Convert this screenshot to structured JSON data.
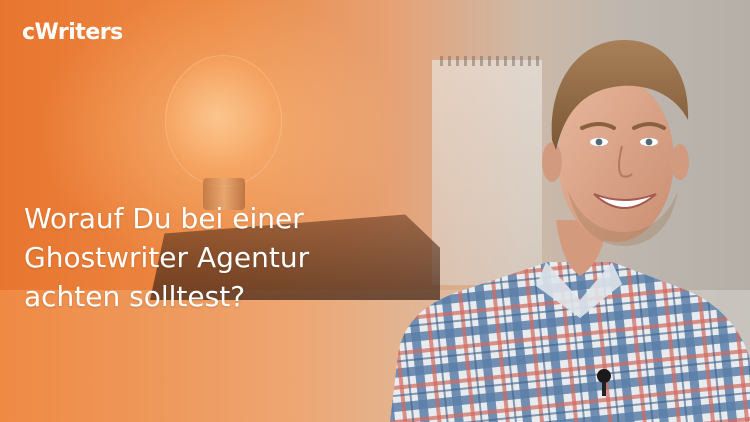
{
  "brand": {
    "logo_text": "cWriters"
  },
  "headline": {
    "lines": [
      "Worauf Du bei einer",
      "Ghostwriter Agentur",
      "achten solltest?"
    ]
  },
  "colors": {
    "accent_orange": "#e8752f",
    "text": "#ffffff",
    "shirt_blue": "#5b7fa8"
  }
}
